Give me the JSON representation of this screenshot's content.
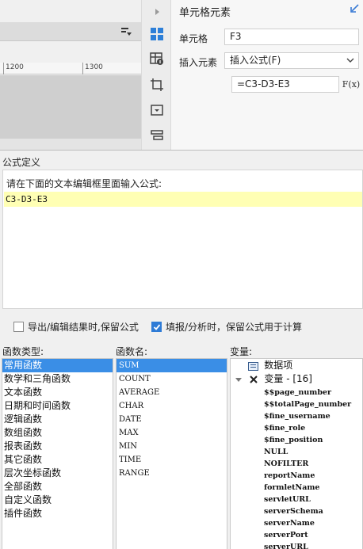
{
  "sheet": {
    "ruler_labels": [
      "1200",
      "1300"
    ]
  },
  "props": {
    "title": "单元格元素",
    "cell_label": "单元格",
    "cell_value": "F3",
    "insert_label": "插入元素",
    "insert_value": "插入公式(F)",
    "formula_value": "=C3-D3-E3",
    "fx_label": "F(x)"
  },
  "dialog": {
    "title": "公式定义",
    "hint": "请在下面的文本编辑框里面输入公式:",
    "formula": "C3-D3-E3",
    "option1": "导出/编辑结果时,保留公式",
    "option2": "填报/分析时，保留公式用于计算",
    "option1_checked": false,
    "option2_checked": true,
    "function_types_label": "函数类型:",
    "function_names_label": "函数名:",
    "variables_label": "变量:",
    "function_types": [
      "常用函数",
      "数学和三角函数",
      "文本函数",
      "日期和时间函数",
      "逻辑函数",
      "数组函数",
      "报表函数",
      "其它函数",
      "层次坐标函数",
      "全部函数",
      "自定义函数",
      "插件函数"
    ],
    "selected_type": "常用函数",
    "function_names": [
      "SUM",
      "COUNT",
      "AVERAGE",
      "CHAR",
      "DATE",
      "MAX",
      "MIN",
      "TIME",
      "RANGE"
    ],
    "selected_name": "SUM",
    "variable_root": "数据项",
    "variable_group": "变量 - [16]",
    "variables": [
      "$$page_number",
      "$$totalPage_number",
      "$fine_username",
      "$fine_role",
      "$fine_position",
      "NULL",
      "NOFILTER",
      "reportName",
      "formletName",
      "servletURL",
      "serverSchema",
      "serverName",
      "serverPort",
      "serverURL"
    ]
  },
  "colors": {
    "accent": "#3a8ee6",
    "editor_bg": "#ffffb4",
    "checkbox_checked": "#2e7bd6"
  }
}
